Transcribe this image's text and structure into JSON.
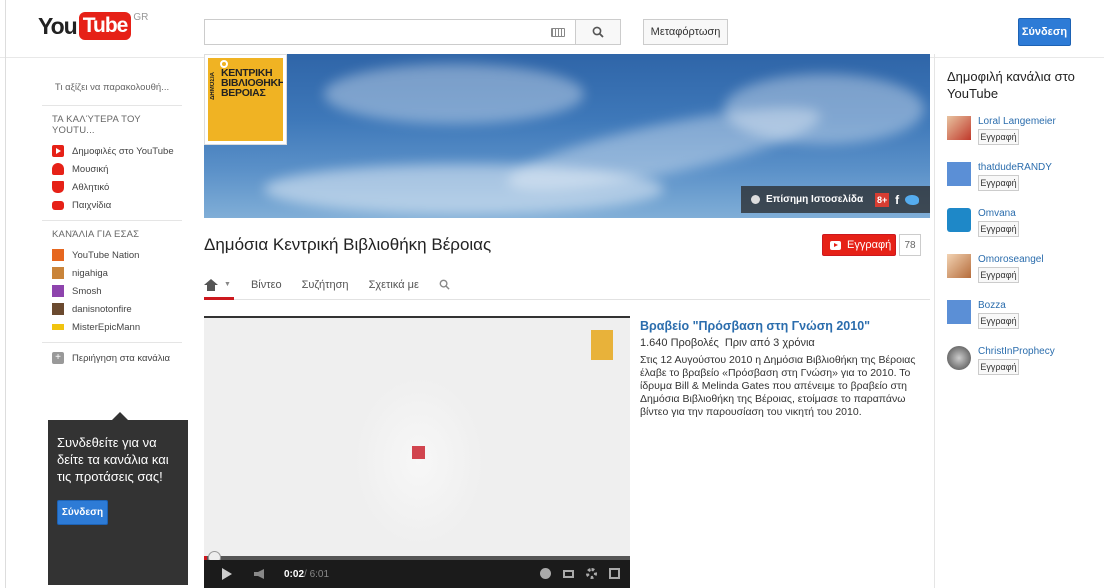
{
  "header": {
    "logo_you": "You",
    "logo_tube": "Tube",
    "logo_region": "GR",
    "search_placeholder": "",
    "upload_label": "Μεταφόρτωση",
    "signin_label": "Σύνδεση"
  },
  "sidebar": {
    "whats_on": "Τι αξίζει να παρακολουθή...",
    "best_title": "ΤΑ ΚΑΛΎΤΕΡΑ ΤΟΥ YOUTU...",
    "best_items": [
      {
        "label": "Δημοφιλές στο YouTube",
        "icon": "popular-icon",
        "color": "#e62117"
      },
      {
        "label": "Μουσική",
        "icon": "headphones-icon",
        "color": "#e62117"
      },
      {
        "label": "Αθλητικό",
        "icon": "trophy-icon",
        "color": "#e62117"
      },
      {
        "label": "Παιχνίδια",
        "icon": "gamepad-icon",
        "color": "#e62117"
      }
    ],
    "channels_title": "ΚΑΝΆΛΙΑ ΓΙΑ ΕΣΑΣ",
    "channel_items": [
      {
        "label": "YouTube Nation"
      },
      {
        "label": "nigahiga"
      },
      {
        "label": "Smosh"
      },
      {
        "label": "danisnotonfire"
      },
      {
        "label": "MisterEpicMann"
      }
    ],
    "browse_label": "Περιήγηση στα κανάλια",
    "promo_text": "Συνδεθείτε για να δείτε τα κανάλια και τις προτάσεις σας!",
    "promo_button": "Σύνδεση"
  },
  "banner": {
    "logo_line1": "ΚΕΝΤΡΙΚΗ",
    "logo_line2": "ΒΙΒΛΙΟΘΗΚΗ",
    "logo_line3": "ΒΕΡΟΙΑΣ",
    "logo_side": "ΔΗΜΟΣΙΑ",
    "official_site": "Επίσημη Ιστοσελίδα",
    "gplus": "8+",
    "fb": "f"
  },
  "channel": {
    "title": "Δημόσια Κεντρική Βιβλιοθήκη Βέροιας",
    "subscribe_label": "Εγγραφή",
    "subscriber_count": "78",
    "tabs": [
      "Βίντεο",
      "Συζήτηση",
      "Σχετικά με"
    ]
  },
  "video": {
    "current_time": "0:02",
    "duration": "/ 6:01",
    "progress": 0.006,
    "title": "Βραβείο \"Πρόσβαση στη Γνώση 2010\"",
    "views": "1.640 Προβολές",
    "age": "Πριν από 3 χρόνια",
    "description": "Στις 12 Αυγούστου 2010 η Δημόσια Βιβλιοθήκη της Βέροιας έλαβε το βραβείο «Πρόσβαση στη Γνώση» για το 2010. Το ίδρυμα Bill & Melinda Gates που απένειμε το βραβείο στη Δημόσια Βιβλιοθήκη της Βέροιας, ετοίμασε το παραπάνω βίντεο για την παρουσίαση του νικητή του 2010."
  },
  "right": {
    "title": "Δημοφιλή κανάλια στο YouTube",
    "subscribe_label": "Εγγραφή",
    "channels": [
      {
        "name": "Loral Langemeier",
        "color": "#c0392b"
      },
      {
        "name": "thatdudeRANDY",
        "color": "#5b8fd6"
      },
      {
        "name": "Omvana",
        "color": "#1e88c8"
      },
      {
        "name": "Omoroseangel",
        "color": "#b56c3b"
      },
      {
        "name": "Bozza",
        "color": "#5b8fd6"
      },
      {
        "name": "ChristInProphecy",
        "color": "#555555"
      }
    ]
  }
}
